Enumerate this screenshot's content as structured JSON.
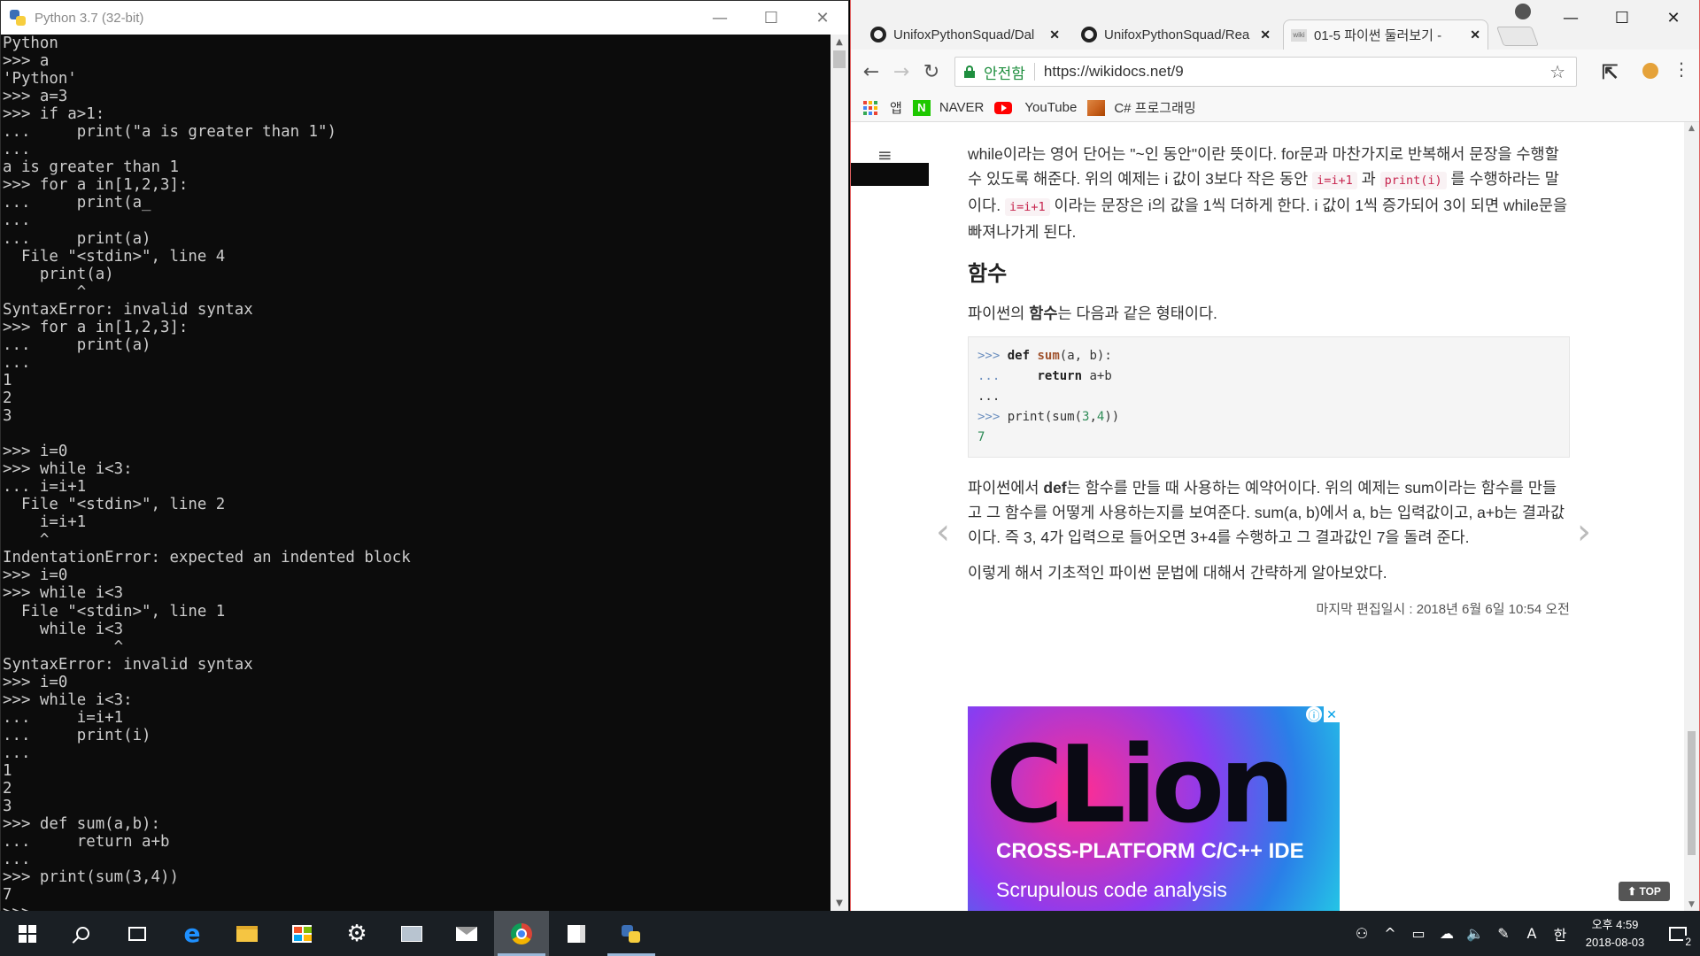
{
  "python_window": {
    "title": "Python 3.7 (32-bit)",
    "controls": {
      "minimize": "—",
      "maximize": "☐",
      "close": "✕"
    },
    "console_lines": [
      "Python",
      ">>> a",
      "'Python'",
      ">>> a=3",
      ">>> if a>1:",
      "...     print(\"a is greater than 1\")",
      "...",
      "a is greater than 1",
      ">>> for a in[1,2,3]:",
      "...     print(a_",
      "...",
      "...     print(a)",
      "  File \"<stdin>\", line 4",
      "    print(a)",
      "        ^",
      "SyntaxError: invalid syntax",
      ">>> for a in[1,2,3]:",
      "...     print(a)",
      "...",
      "1",
      "2",
      "3",
      "",
      ">>> i=0",
      ">>> while i<3:",
      "... i=i+1",
      "  File \"<stdin>\", line 2",
      "    i=i+1",
      "    ^",
      "IndentationError: expected an indented block",
      ">>> i=0",
      ">>> while i<3",
      "  File \"<stdin>\", line 1",
      "    while i<3",
      "            ^",
      "SyntaxError: invalid syntax",
      ">>> i=0",
      ">>> while i<3:",
      "...     i=i+1",
      "...     print(i)",
      "...",
      "1",
      "2",
      "3",
      ">>> def sum(a,b):",
      "...     return a+b",
      "...",
      ">>> print(sum(3,4))",
      "7",
      ">>>"
    ]
  },
  "browser": {
    "tabs": [
      {
        "title": "UnifoxPythonSquad/Dal",
        "close": "✕"
      },
      {
        "title": "UnifoxPythonSquad/Rea",
        "close": "✕"
      },
      {
        "title": "01-5 파이썬 둘러보기 -",
        "close": "✕",
        "icon_text": "wiki"
      }
    ],
    "controls": {
      "minimize": "—",
      "maximize": "☐",
      "close": "✕"
    },
    "nav": {
      "back": "←",
      "forward": "→",
      "reload": "↻"
    },
    "omnibox": {
      "secure_label": "안전함",
      "url": "https://wikidocs.net/9",
      "star": "☆"
    },
    "toolbar_icons": {
      "ext1": "⇱",
      "menu": "⋮"
    },
    "bookmarks": [
      {
        "label": "앱"
      },
      {
        "label": "NAVER",
        "logo_text": "N"
      },
      {
        "label": "YouTube"
      },
      {
        "label": "C# 프로그래밍"
      }
    ],
    "page": {
      "hamburger": "≡",
      "para1_a": "while이라는 영어 단어는 \"~인 동안\"이란 뜻이다. for문과 마찬가지로 반복해서 문장을 수행할 수 있도록 해준다. 위의 예제는 i 값이 3보다 작은 동안 ",
      "code_a": "i=i+1",
      "para1_b": " 과 ",
      "code_b": "print(i)",
      "para1_c": " 를 수행하라는 말이다. ",
      "code_c": "i=i+1",
      "para1_d": " 이라는 문장은 i의 값을 1씩 더하게 한다. i 값이 1씩 증가되어 3이 되면 while문을 빠져나가게 된다.",
      "heading": "함수",
      "para2_a": "파이썬의 ",
      "para2_bold": "함수",
      "para2_b": "는 다음과 같은 형태이다.",
      "code_block": {
        "l1_prompt": ">>>",
        "l1_kw": "def",
        "l1_fn": "sum",
        "l1_rest": "(a, b):",
        "l2_prompt": "...",
        "l2_kw": "return",
        "l2_rest": " a+b",
        "l3": "...",
        "l4_prompt": ">>>",
        "l4_rest_a": " print(sum(",
        "l4_n1": "3",
        "l4_comma": ",",
        "l4_n2": "4",
        "l4_rest_b": "))",
        "l5": "7"
      },
      "para3_a": "파이썬에서 ",
      "para3_bold": "def",
      "para3_b": "는 함수를 만들 때 사용하는 예약어이다. 위의 예제는 sum이라는 함수를 만들고 그 함수를 어떻게 사용하는지를 보여준다. sum(a, b)에서 a, b는 입력값이고, a+b는 결과값이다. 즉 3, 4가 입력으로 들어오면 3+4를 수행하고 그 결과값인 7을 돌려 준다.",
      "para4": "이렇게 해서 기초적인 파이썬 문법에 대해서 간략하게 알아보았다.",
      "last_edited": "마지막 편집일시 : 2018년 6월 6일 10:54 오전",
      "ad": {
        "title": "CLion",
        "subtitle": "CROSS-PLATFORM C/C++ IDE",
        "tagline": "Scrupulous code analysis",
        "info": "ⓘ",
        "close": "✕"
      },
      "prev": "‹",
      "next": "›",
      "top_button": "⬆ TOP"
    }
  },
  "taskbar": {
    "tray": {
      "people": "⚇",
      "chevron": "^",
      "battery": "▭",
      "network": "☁",
      "volume": "🔈",
      "pen": "✎",
      "ime_a": "A",
      "ime_han": "한",
      "time": "오후 4:59",
      "date": "2018-08-03",
      "notification_count": "2"
    }
  }
}
